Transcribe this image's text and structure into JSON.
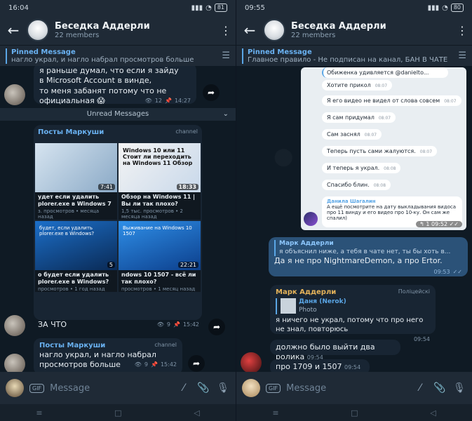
{
  "left": {
    "status": {
      "time": "16:04",
      "battery": "81"
    },
    "header": {
      "title": "Беседка Аддерли",
      "subtitle": "22 members"
    },
    "pinned": {
      "title": "Pinned Message",
      "body": "нагло украл, и нагло набрал просмотров больше"
    },
    "msg1": {
      "lines": [
        "я раньше думал, что если я зайду",
        "в Microsoft Account в винде,",
        "то меня забанят потому что не",
        "официальная 😱"
      ],
      "views": "12",
      "time": "14:27"
    },
    "unread": "Unread Messages",
    "repost1": {
      "channel": "Посты Маркуши",
      "badge": "channel",
      "videos": [
        {
          "thumb_text": "",
          "duration": "7:41",
          "title": "удет если удалить plorer.exe в Windows 7",
          "meta": "з. просмотров • месяца назад"
        },
        {
          "thumb_text": "Windows 10 или 11 Стоит ли переходить на Windows 11 Обзор",
          "duration": "18:33",
          "title": "Обзор на Windows 11 | Вы ли так плохо?",
          "meta": "1,5 тыс. просмотров • 2 месяца назад"
        },
        {
          "thumb_text": "будет, если удалить plorer.exe в Windows?",
          "duration": "5",
          "title": "о будет если удалить plorer.exe в Windows?",
          "meta": "просмотров • 1 год назад"
        },
        {
          "thumb_text": "Выживание на Windows 10 1507",
          "duration": "22:21",
          "title": "ndows 10 1507 - всё ли так плохо?",
          "meta": "просмотров • 1 месяц назад"
        }
      ]
    },
    "msg2": {
      "text": "ЗА ЧТО",
      "views": "9",
      "time": "15:42"
    },
    "repost2": {
      "channel": "Посты Маркуши",
      "badge": "channel",
      "lines": [
        "нагло украл, и нагло набрал",
        "просмотров больше"
      ],
      "views": "9",
      "time": "15:42"
    },
    "input_placeholder": "Message",
    "gif_label": "GIF"
  },
  "right": {
    "status": {
      "time": "09:55",
      "battery": "80"
    },
    "header": {
      "title": "Беседка Аддерли",
      "subtitle": "22 members"
    },
    "pinned": {
      "title": "Pinned Message",
      "body": "Главное правило - Не подписан на канал, БАН В ЧАТЕ"
    },
    "shot": {
      "quote_text": "Обиженка удивляется @danielto...",
      "messages": [
        {
          "text": "Хотите прикол",
          "time": "08:07"
        },
        {
          "text": "Я его видео не видел от слова совсем",
          "time": "08:07"
        },
        {
          "text": "Я сам придумал",
          "time": "08:07"
        },
        {
          "text": "Сам заснял",
          "time": "08:07"
        },
        {
          "text": "Теперь пусть сами жалуются.",
          "time": "08:07"
        },
        {
          "text": "И теперь я украл.",
          "time": "08:08"
        },
        {
          "text": "Спасибо блин.",
          "time": "08:08"
        }
      ],
      "last": {
        "name": "Данила Шагалин",
        "text": "А ещё посмотрите на дату выкладывания видоса про 11 винду и его видео про 10-ку. Он сам же спалил)",
        "time": "09:52",
        "reply_count": "1"
      }
    },
    "out_msg": {
      "reply_name": "Марк Аддерли",
      "reply_text": "я объяснил ниже, а тебя в чате нет, ты бы хоть в...",
      "text": "Да я не про NightmareDemon, а про Ertor.",
      "time": "09:53"
    },
    "in_msg": {
      "name": "Марк Аддерли",
      "role": "Поліцейскі",
      "reply_name": "Даня (Nerok)",
      "reply_text": "Photo",
      "text": "я ничего не украл, потому что про него не знал, повторюсь",
      "time": "09:54"
    },
    "in_msg2": {
      "text": "должно было выйти два ролика",
      "time": "09:54"
    },
    "in_msg3": {
      "text": "про 1709 и 1507",
      "time": "09:54"
    },
    "input_placeholder": "Message",
    "gif_label": "GIF"
  }
}
